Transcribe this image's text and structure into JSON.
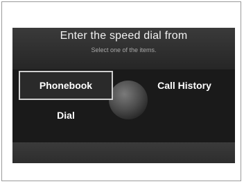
{
  "screen": {
    "title": "Enter the speed dial from",
    "subtitle": "Select one of the items."
  },
  "options": {
    "phonebook": "Phonebook",
    "call_history": "Call History",
    "dial": "Dial"
  },
  "selected_option": "Phonebook",
  "colors": {
    "screen_background": "#2b2b2b",
    "highlight_border": "#cfcfcf",
    "text": "#ffffff"
  }
}
